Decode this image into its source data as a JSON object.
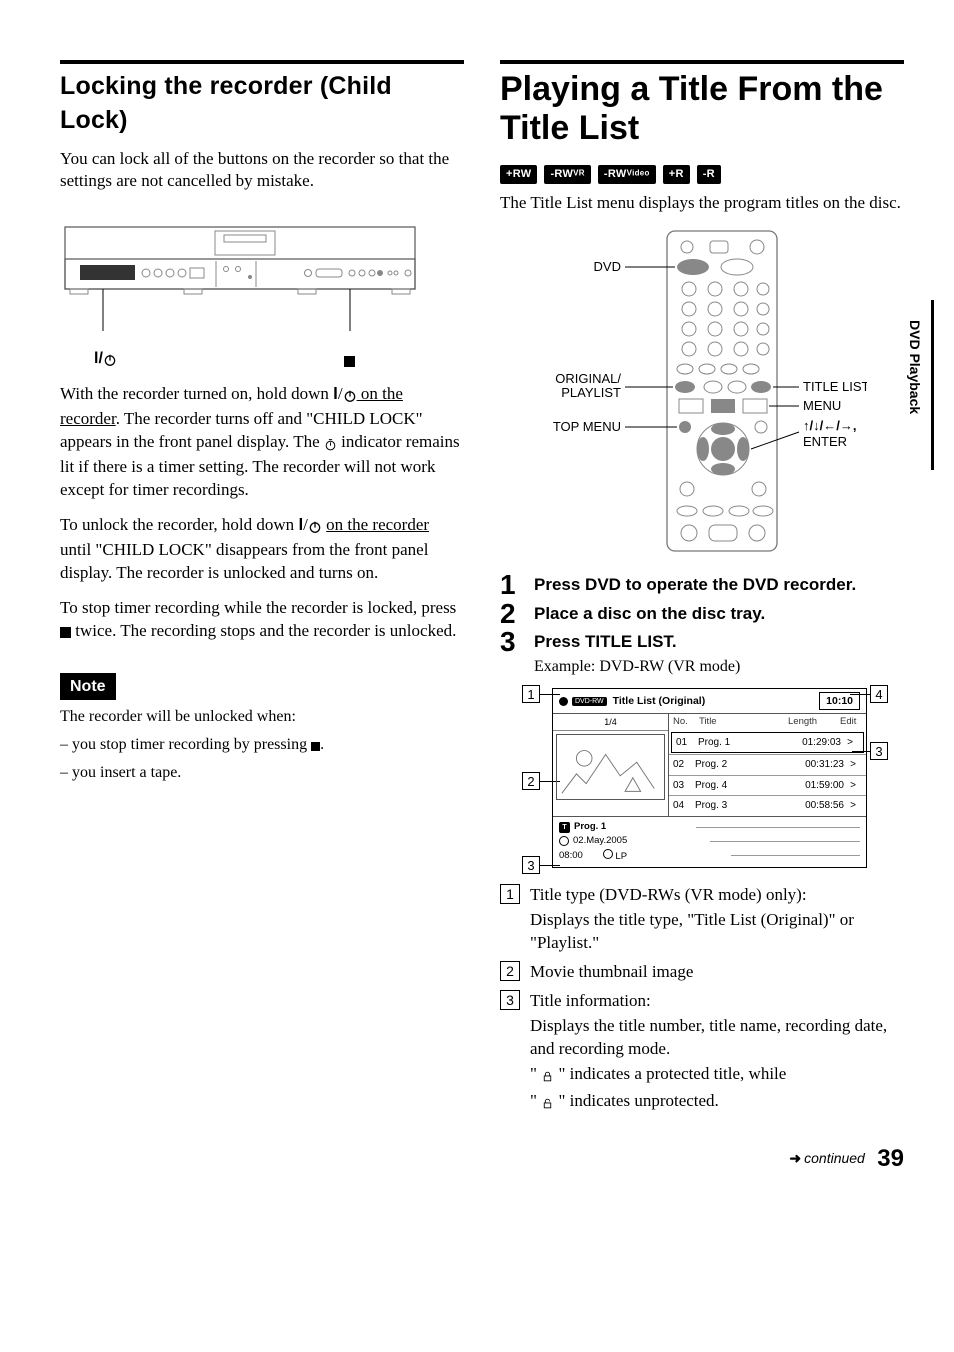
{
  "left": {
    "heading": "Locking the recorder (Child Lock)",
    "intro": "You can lock all of the buttons on the recorder so that the settings are not cancelled by mistake.",
    "labels": {
      "power": "⏻",
      "stop": "■"
    },
    "p1a": "With the recorder turned on, hold down ",
    "p1b": " on the recorder",
    "p1c": ". The recorder turns off and \"CHILD LOCK\" appears in the front panel display. The ",
    "p1d": " indicator remains lit if there is a timer setting. The recorder will not work except for timer recordings.",
    "p2a": "To unlock the recorder, hold down ",
    "p2b": " on the recorder",
    "p2c": " until \"CHILD LOCK\" disappears from the front panel display. The recorder is unlocked and turns on.",
    "p3a": "To stop timer recording while the recorder is locked, press ",
    "p3b": " twice. The recording stops and the recorder is unlocked.",
    "note_label": "Note",
    "note_intro": "The recorder will be unlocked when:",
    "note_item1a": "– you stop timer recording by pressing ",
    "note_item1b": ".",
    "note_item2": "– you insert a tape."
  },
  "right": {
    "heading": "Playing a Title From the Title List",
    "badges": [
      "+RW",
      "-RWVR",
      "-RWVideo",
      "+R",
      "-R"
    ],
    "intro": "The Title List menu displays the program titles on the disc.",
    "remote_labels": {
      "dvd": "DVD",
      "orig_play": "ORIGINAL/\nPLAYLIST",
      "top_menu": "TOP MENU",
      "title_list": "TITLE LIST",
      "menu": "MENU",
      "arrows_enter": "↑/↓/←/→, \nENTER"
    },
    "steps": [
      {
        "head": "Press DVD to operate the DVD recorder."
      },
      {
        "head": "Place a disc on the disc tray."
      },
      {
        "head": "Press TITLE LIST.",
        "sub": "Example: DVD-RW (VR mode)"
      }
    ],
    "tl_screen": {
      "chip": "DVD-RW",
      "title": "Title List (Original)",
      "time": "10:10",
      "thumb_counter": "1/4",
      "cols": {
        "no": "No.",
        "title": "Title",
        "length": "Length",
        "edit": "Edit"
      },
      "rows": [
        {
          "no": "01",
          "title": "Prog. 1",
          "length": "01:29:03",
          "edit": ">"
        },
        {
          "no": "02",
          "title": "Prog. 2",
          "length": "00:31:23",
          "edit": ">"
        },
        {
          "no": "03",
          "title": "Prog. 4",
          "length": "01:59:00",
          "edit": ">"
        },
        {
          "no": "04",
          "title": "Prog. 3",
          "length": "00:58:56",
          "edit": ">"
        }
      ],
      "info": {
        "title": "Prog. 1",
        "date": "02.May.2005",
        "time": "08:00",
        "mode": "LP"
      }
    },
    "legend": [
      {
        "n": "1",
        "head": "Title type (DVD-RWs (VR mode) only):",
        "body": "Displays the title type, \"Title List (Original)\" or \"Playlist.\""
      },
      {
        "n": "2",
        "head": "Movie thumbnail image"
      },
      {
        "n": "3",
        "head": "Title information:",
        "body": "Displays the title number, title name, recording date, and recording mode.",
        "extra1a": "\" ",
        "extra1b": " \" indicates a protected title, while",
        "extra2a": "\" ",
        "extra2b": " \" indicates unprotected."
      }
    ]
  },
  "side_tab": "DVD Playback",
  "footer": {
    "continued": "continued",
    "page": "39"
  }
}
